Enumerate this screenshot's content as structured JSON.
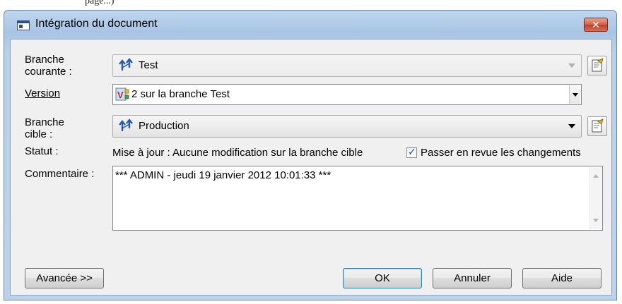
{
  "window": {
    "title": "Intégration du document",
    "close_glyph": "✕"
  },
  "labels": {
    "branche_courante": [
      "Branche",
      "courante :"
    ],
    "version": "Version",
    "branche_cible": [
      "Branche",
      "cible :"
    ],
    "statut": "Statut :",
    "commentaire": "Commentaire :"
  },
  "fields": {
    "branche_courante": "Test",
    "version": "2 sur la branche Test",
    "branche_cible": "Production",
    "statut_text": "Mise à jour : Aucune modification sur la branche cible",
    "review_checkbox_label": "Passer en revue les changements",
    "review_checked": true,
    "commentaire": "*** ADMIN - jeudi 19 janvier 2012 10:01:33 ***"
  },
  "buttons": {
    "advanced": "Avancée >>",
    "ok": "OK",
    "cancel": "Annuler",
    "help": "Aide"
  },
  "top_fragment": "page...)",
  "colors": {
    "branch_icon": "#2a5cae",
    "version_icon": "#b22c2c",
    "accent": "#3c7fb1"
  }
}
